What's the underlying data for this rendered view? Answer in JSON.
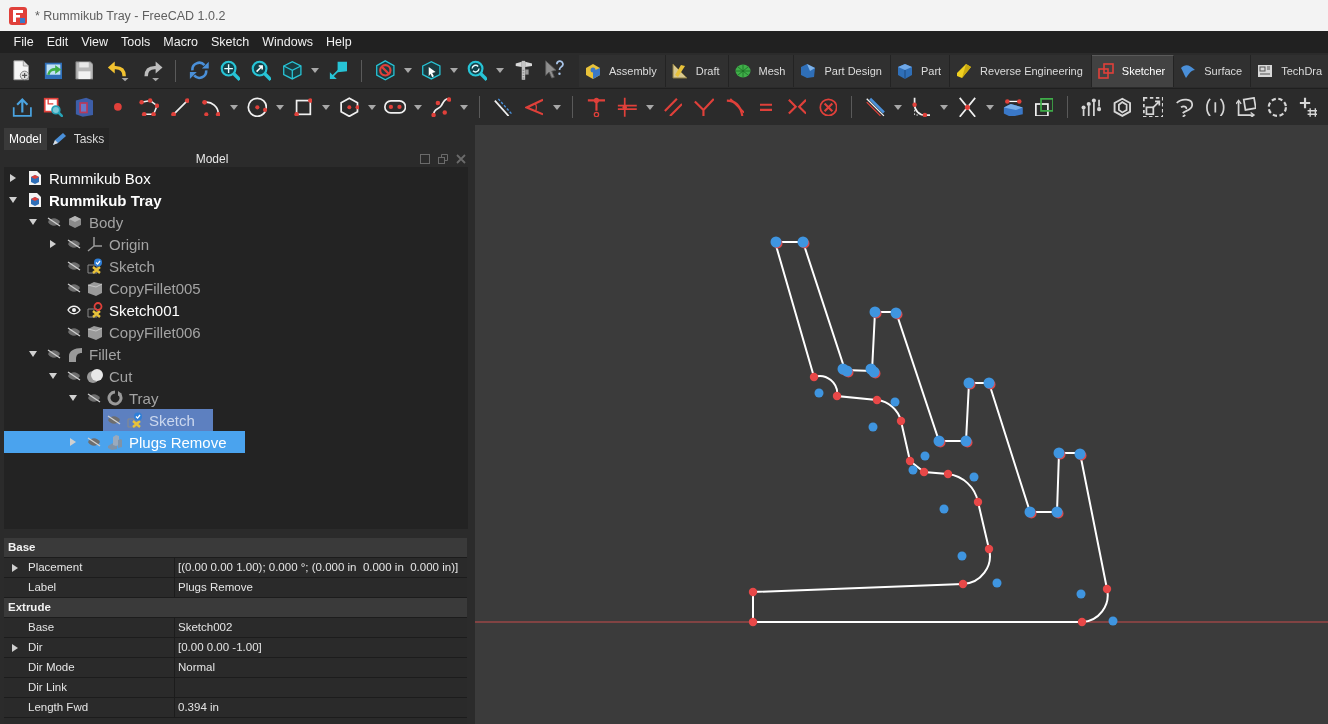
{
  "window": {
    "title": "* Rummikub Tray - FreeCAD 1.0.2"
  },
  "menu": [
    "File",
    "Edit",
    "View",
    "Tools",
    "Macro",
    "Sketch",
    "Windows",
    "Help"
  ],
  "workbench_tabs": [
    {
      "label": "Assembly",
      "selected": false
    },
    {
      "label": "Draft",
      "selected": false
    },
    {
      "label": "Mesh",
      "selected": false
    },
    {
      "label": "Part Design",
      "selected": false
    },
    {
      "label": "Part",
      "selected": false
    },
    {
      "label": "Reverse Engineering",
      "selected": false
    },
    {
      "label": "Sketcher",
      "selected": true
    },
    {
      "label": "Surface",
      "selected": false
    },
    {
      "label": "TechDra",
      "selected": false
    }
  ],
  "panel_tabs": [
    {
      "label": "Model",
      "selected": true
    },
    {
      "label": "Tasks",
      "selected": false
    }
  ],
  "tree_header": {
    "title": "Model"
  },
  "model_tree": [
    {
      "label": "Rummikub Box",
      "kind": "document",
      "active": false,
      "expanded": false,
      "selected": false,
      "highlighted": false
    },
    {
      "label": "Rummikub Tray",
      "kind": "document",
      "active": true,
      "expanded": true,
      "selected": false,
      "highlighted": false,
      "children": [
        {
          "label": "Body",
          "kind": "body",
          "visible": false,
          "expanded": true,
          "selected": false,
          "highlighted": false,
          "children": [
            {
              "label": "Origin",
              "kind": "origin",
              "visible": false,
              "expanded": false,
              "selected": false,
              "highlighted": false
            },
            {
              "label": "Sketch",
              "kind": "sketch",
              "visible": false,
              "error": false,
              "selected": false,
              "highlighted": false
            },
            {
              "label": "CopyFillet005",
              "kind": "solid",
              "visible": false,
              "selected": false,
              "highlighted": false
            },
            {
              "label": "Sketch001",
              "kind": "sketch",
              "visible": true,
              "error": true,
              "selected": false,
              "highlighted": false
            },
            {
              "label": "CopyFillet006",
              "kind": "solid",
              "visible": false,
              "selected": false,
              "highlighted": false
            }
          ]
        },
        {
          "label": "Fillet",
          "kind": "fillet",
          "visible": false,
          "expanded": true,
          "selected": false,
          "highlighted": false,
          "children": [
            {
              "label": "Cut",
              "kind": "cut",
              "visible": false,
              "expanded": true,
              "selected": false,
              "highlighted": false,
              "children": [
                {
                  "label": "Tray",
                  "kind": "revolution",
                  "visible": false,
                  "expanded": true,
                  "selected": false,
                  "highlighted": false,
                  "children": [
                    {
                      "label": "Sketch",
                      "kind": "sketch",
                      "visible": false,
                      "error": false,
                      "selected": false,
                      "highlighted": true
                    }
                  ]
                },
                {
                  "label": "Plugs Remove",
                  "kind": "extrusion",
                  "visible": false,
                  "expanded": false,
                  "selected": true,
                  "highlighted": false
                }
              ]
            }
          ]
        }
      ]
    }
  ],
  "property_view": {
    "groups": [
      {
        "name": "Base",
        "properties": [
          {
            "name": "Placement",
            "value": "[(0.00 0.00 1.00); 0.000 °; (0.000 in  0.000 in  0.000 in)]",
            "expanded": false
          },
          {
            "name": "Label",
            "value": "Plugs Remove"
          }
        ]
      },
      {
        "name": "Extrude",
        "properties": [
          {
            "name": "Base",
            "value": "Sketch002"
          },
          {
            "name": "Dir",
            "value": "[0.00 0.00 -1.00]",
            "expanded": false
          },
          {
            "name": "Dir Mode",
            "value": "Normal"
          },
          {
            "name": "Dir Link"
          },
          {
            "name": "Length Fwd",
            "value": "0.394 in"
          }
        ]
      }
    ]
  }
}
